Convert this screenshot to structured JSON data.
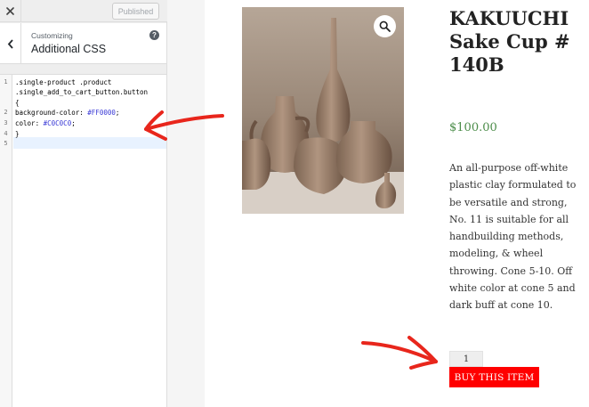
{
  "customizer": {
    "publish_label": "Published",
    "customizing_label": "Customizing",
    "section_title": "Additional CSS",
    "help_glyph": "?",
    "icons": {
      "close": "close-icon",
      "back": "chevron-left-icon",
      "help": "help-icon"
    }
  },
  "editor": {
    "line_numbers": [
      "1",
      "2",
      "3",
      "4",
      "5"
    ],
    "code": {
      "line1a": ".single-product .product",
      "line1b": ".single_add_to_cart_button.button",
      "line1c": "{",
      "line2_prop": "background-color: ",
      "line2_val": "#FF0000",
      "line2_end": ";",
      "line3_prop": "color: ",
      "line3_val": "#C0C0C0",
      "line3_end": ";",
      "line4": "}"
    }
  },
  "product": {
    "title": "KAKUUCHI Sake Cup #140B",
    "price": "$100.00",
    "description": "An all-purpose off-white plastic clay formulated to be versatile and strong, No. 11 is suitable for all handbuilding methods, modeling, & wheel throwing. Cone 5-10. Off white color at cone 5 and dark buff at cone 10.",
    "quantity": "1",
    "buy_label": "BUY THIS ITEM",
    "zoom_icon": "magnifier-icon"
  },
  "colors": {
    "annotation_arrow": "#e8261c",
    "button_background": "#FF0000",
    "price": "#4c8d4a"
  }
}
